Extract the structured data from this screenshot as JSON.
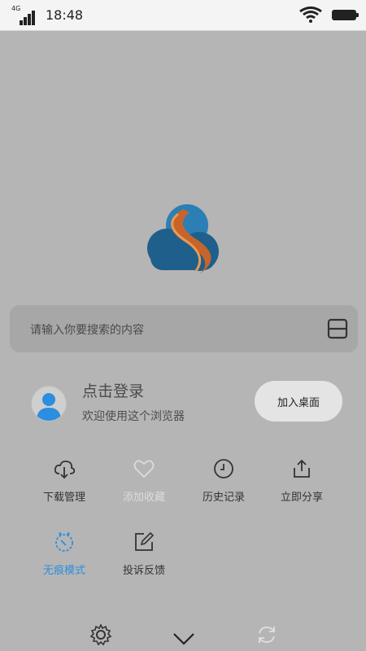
{
  "status_bar": {
    "network": "4G",
    "time": "18:48"
  },
  "search": {
    "placeholder": "请输入你要搜索的内容"
  },
  "login": {
    "title": "点击登录",
    "subtitle": "欢迎使用这个浏览器",
    "add_desktop": "加入桌面"
  },
  "actions": [
    {
      "label": "下载管理",
      "icon": "cloud-download-icon"
    },
    {
      "label": "添加收藏",
      "icon": "heart-icon"
    },
    {
      "label": "历史记录",
      "icon": "clock-icon"
    },
    {
      "label": "立即分享",
      "icon": "share-icon"
    },
    {
      "label": "无痕模式",
      "icon": "incognito-icon"
    },
    {
      "label": "投诉反馈",
      "icon": "feedback-icon"
    }
  ],
  "bottom_bar": [
    "settings-icon",
    "chevron-down-icon",
    "refresh-icon"
  ],
  "colors": {
    "accent": "#2b8ee0",
    "background": "#b5b5b5",
    "logo_blue": "#1f5f8b",
    "logo_orange": "#c8642a",
    "disabled": "#dcdcdc"
  }
}
